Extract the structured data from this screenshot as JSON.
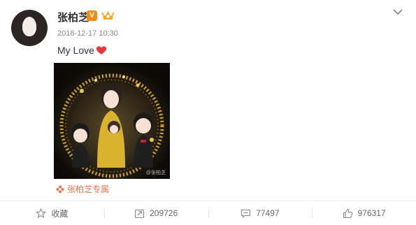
{
  "post": {
    "username": "张柏芝",
    "verified_badge": "V",
    "timestamp": "2018-12-17 10:30",
    "text": "My Love",
    "image_watermark": "@张柏芝",
    "source_label": "张柏芝专属"
  },
  "actions": {
    "favorite_label": "收藏",
    "repost_count": "209726",
    "comment_count": "77497",
    "like_count": "976317"
  },
  "colors": {
    "verified": "#f28a13",
    "source": "#eb7350",
    "heart": "#e8383d",
    "gold": "#e8b52a"
  },
  "icons": {
    "avatar": "avatar",
    "verified": "verified-v-icon",
    "member": "member-crown-icon",
    "menu": "chevron-down-icon",
    "heart": "heart-emoji-icon",
    "source": "source-flower-icon",
    "favorite": "star-icon",
    "repost": "repost-icon",
    "comment": "comment-icon",
    "like": "thumbs-up-icon"
  }
}
